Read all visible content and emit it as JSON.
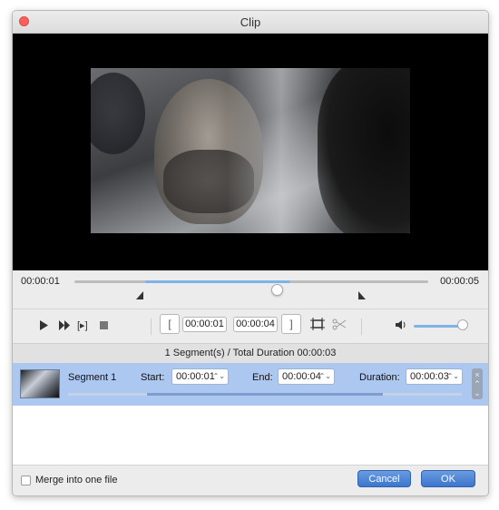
{
  "window": {
    "title": "Clip"
  },
  "timeline": {
    "current_time": "00:00:01",
    "total_time": "00:00:05",
    "progress": 0.28
  },
  "controls": {
    "start_time": "00:00:01",
    "end_time": "00:00:04",
    "icons": [
      "play-icon",
      "fast-forward-icon",
      "clip-to-range-icon",
      "stop-icon",
      "set-start-icon",
      "set-end-icon",
      "crop-icon",
      "split-icon",
      "volume-icon"
    ],
    "volume_level": 0.9
  },
  "summary": {
    "text": "1 Segment(s) / Total Duration 00:00:03"
  },
  "segments": [
    {
      "name": "Segment 1",
      "start_label": "Start:",
      "start_value": "00:00:01",
      "end_label": "End:",
      "end_value": "00:00:04",
      "duration_label": "Duration:",
      "duration_value": "00:00:03"
    }
  ],
  "footer": {
    "merge_label": "Merge into one file",
    "merge_checked": false,
    "cancel_label": "Cancel",
    "ok_label": "OK"
  },
  "colors": {
    "accent": "#3c76cc",
    "selection": "#acc7f0",
    "close": "#fc605c"
  }
}
